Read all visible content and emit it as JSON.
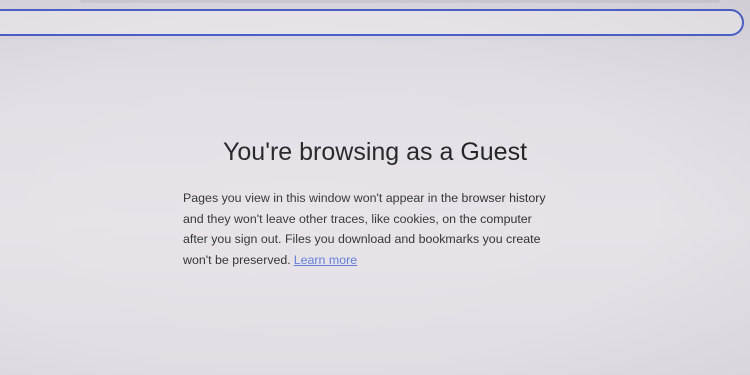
{
  "browser": {
    "omnibox_value": ""
  },
  "guest_page": {
    "title": "You're browsing as a Guest",
    "description_lines": [
      "Pages you view in this window won't appear in the browser history",
      "and they won't leave other traces, like cookies, on the computer",
      "after you sign out. Files you download and bookmarks you create",
      "won't be preserved."
    ],
    "learn_more_label": "Learn more"
  },
  "colors": {
    "background": "#e3dfe6",
    "omnibox_border": "#4a5fc8",
    "link": "#5a78d6",
    "text": "#222222"
  }
}
